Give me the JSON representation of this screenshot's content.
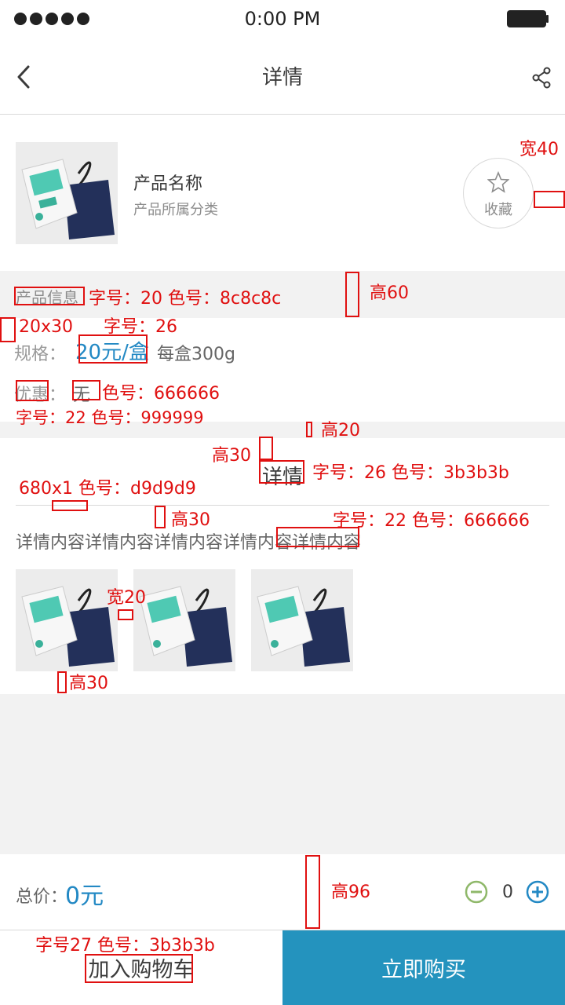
{
  "status_bar": {
    "time": "0:00 PM"
  },
  "nav": {
    "title": "详情"
  },
  "product": {
    "name": "产品名称",
    "category": "产品所属分类",
    "favorite_label": "收藏"
  },
  "info": {
    "section_title": "产品信息",
    "spec_label": "规格：",
    "price": "20元/盒",
    "spec_value": "每盒300g",
    "discount_label": "优惠：",
    "discount_value": "无"
  },
  "detail": {
    "title": "详情",
    "content": "详情内容详情内容详情内容详情内容详情内容"
  },
  "bottom": {
    "total_label": "总价：",
    "total_value": "0元",
    "quantity": "0",
    "add_to_cart": "加入购物车",
    "buy_now": "立即购买"
  },
  "annotations": {
    "a1": "宽40",
    "a2": "字号：20  色号：8c8c8c",
    "a3": "高60",
    "a4": "20x30",
    "a5": "字号：26",
    "a6": "色号：666666",
    "a7": "字号：22  色号：999999",
    "a8": "高20",
    "a9": "高30",
    "a10": "字号：26  色号：3b3b3b",
    "a11": "680x1  色号：d9d9d9",
    "a12": "高30",
    "a13": "字号：22 色号：666666",
    "a14": "宽20",
    "a15": "高30",
    "a16": "高96",
    "a17": "字号27  色号：3b3b3b"
  },
  "colors": {
    "accent": "#2389c4",
    "buy_button": "#2493be",
    "minus": "#8fb86a"
  }
}
